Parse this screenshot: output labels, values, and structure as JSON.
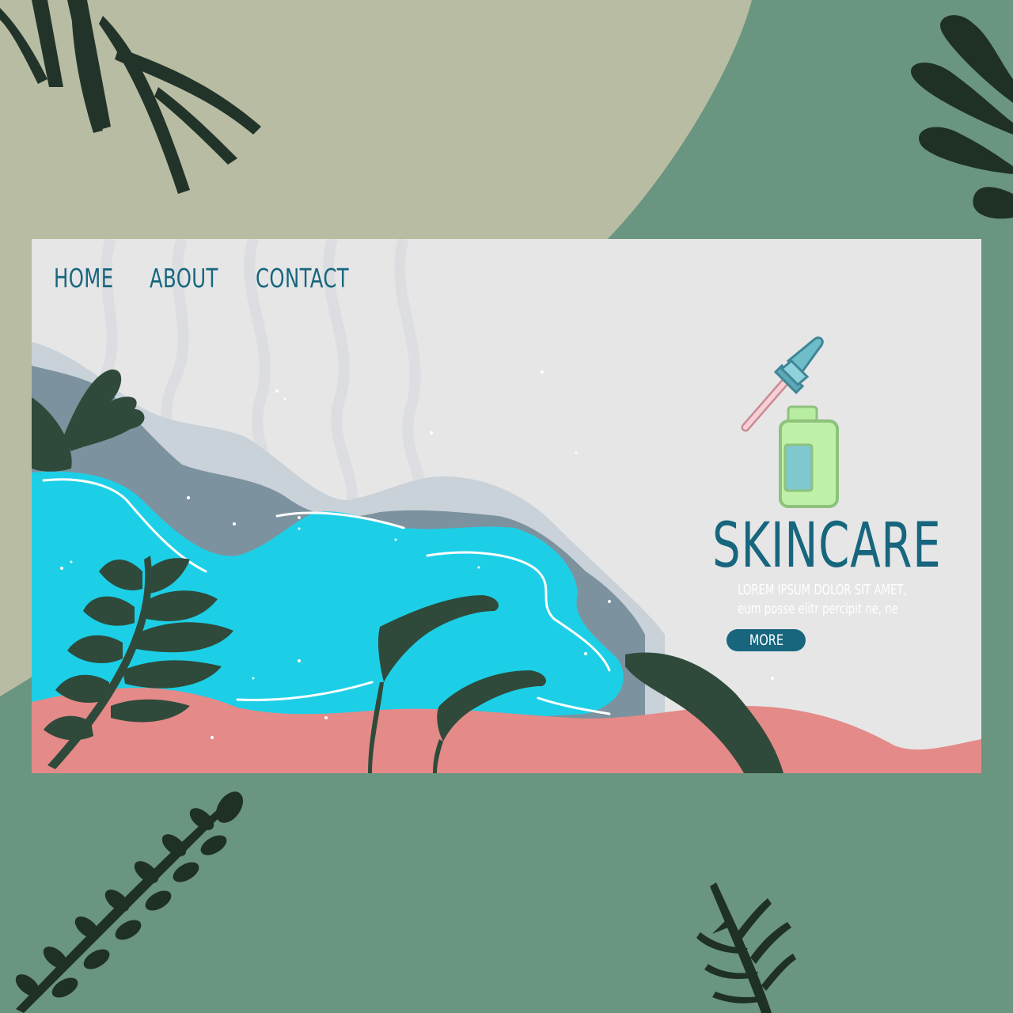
{
  "nav": {
    "items": [
      {
        "label": "HOME"
      },
      {
        "label": "ABOUT"
      },
      {
        "label": "CONTACT"
      }
    ]
  },
  "hero": {
    "title": "SKINCARE",
    "tagline_line1": "LOREM IPSUM DOLOR SIT AMET,",
    "tagline_line2": "eum posse elitr percipit ne, ne",
    "button_label": "MORE"
  },
  "icons": [
    "dropper-icon",
    "serum-bottle-icon",
    "leaf-icon"
  ],
  "colors": {
    "outer_background": "#6a9580",
    "outer_blob": "#b8bca2",
    "card_background": "#e6e6e7",
    "accent": "#17667e",
    "water": "#1ccfe6",
    "sand": "#e48a88",
    "rock": "#7d929f",
    "leaf": "#2f4a3a"
  }
}
